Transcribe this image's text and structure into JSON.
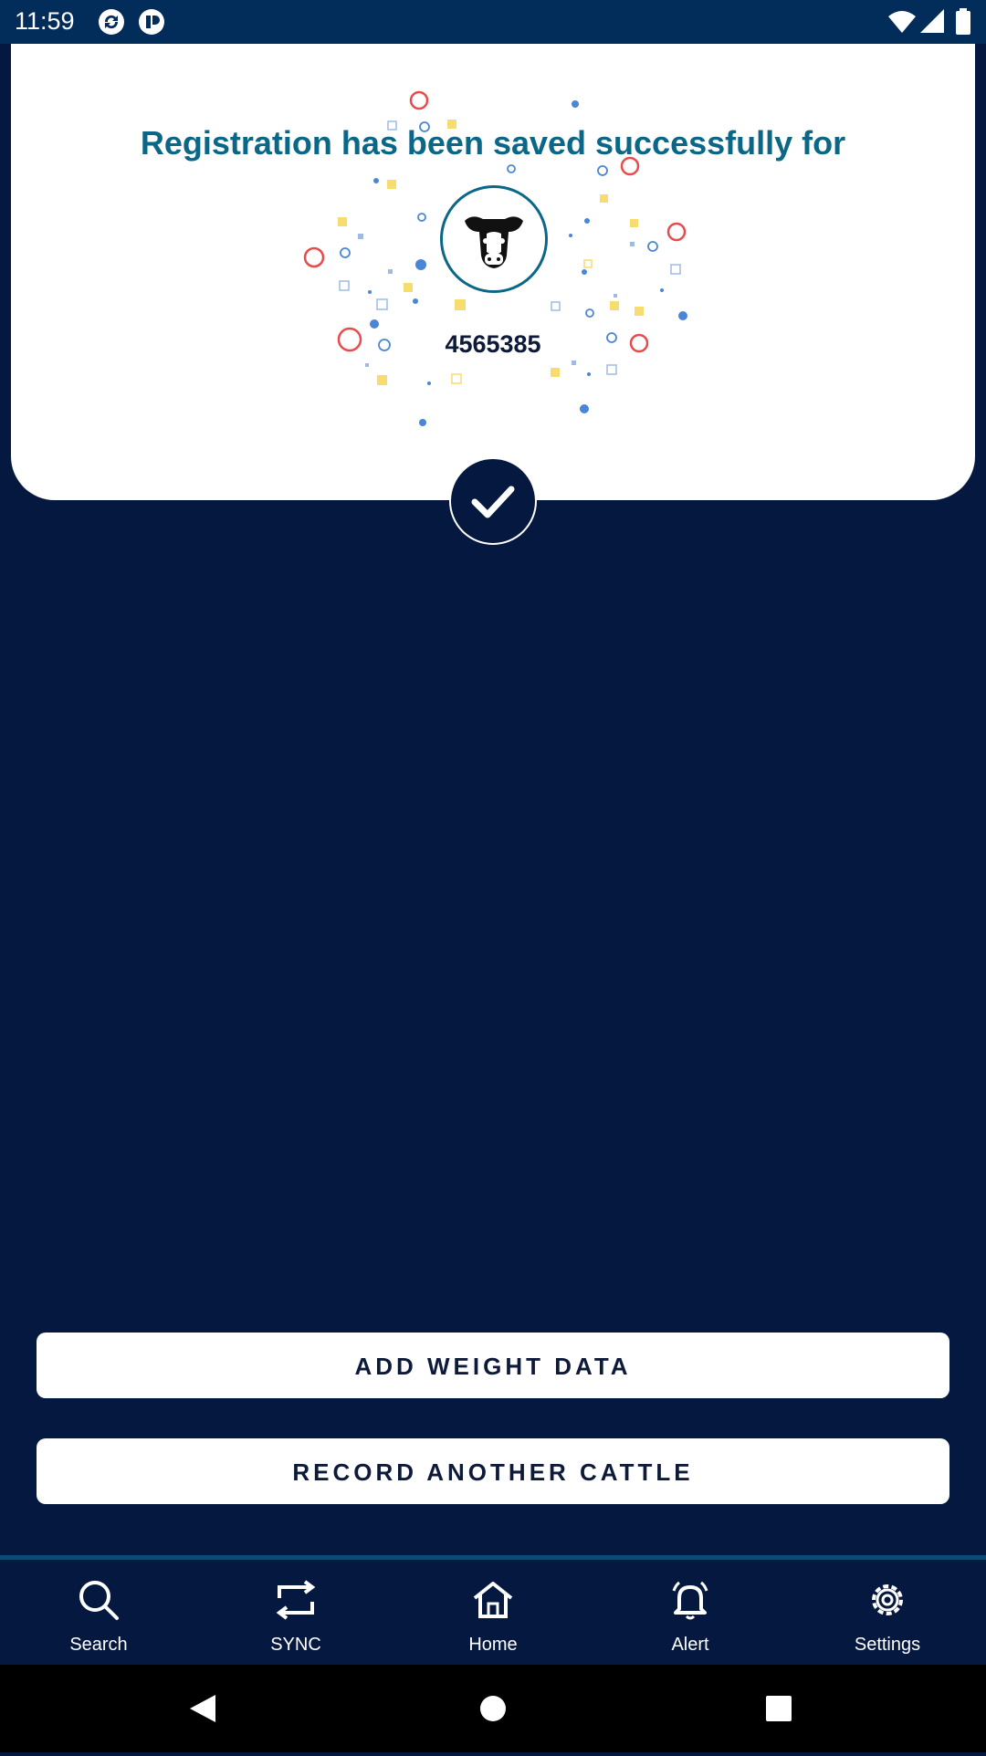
{
  "status_bar": {
    "time": "11:59",
    "icons": [
      "sync-app-icon",
      "app-icon",
      "wifi-icon",
      "cellular-signal-icon",
      "battery-icon"
    ]
  },
  "success_card": {
    "title": "Registration has been saved successfully for",
    "cattle_id": "4565385",
    "avatar_icon": "cow-head-icon",
    "badge_icon": "checkmark-icon"
  },
  "actions": {
    "add_weight_label": "ADD WEIGHT DATA",
    "record_another_label": "RECORD ANOTHER CATTLE"
  },
  "bottom_nav": [
    {
      "label": "Search",
      "icon": "search-icon"
    },
    {
      "label": "SYNC",
      "icon": "sync-icon"
    },
    {
      "label": "Home",
      "icon": "home-icon"
    },
    {
      "label": "Alert",
      "icon": "bell-icon"
    },
    {
      "label": "Settings",
      "icon": "gear-icon"
    }
  ],
  "system_nav": {
    "icons": [
      "back-icon",
      "home-circle-icon",
      "recents-icon"
    ]
  },
  "colors": {
    "background": "#041840",
    "status_bar": "#022c5a",
    "title": "#0b6787",
    "button_text": "#0e1a3a"
  }
}
